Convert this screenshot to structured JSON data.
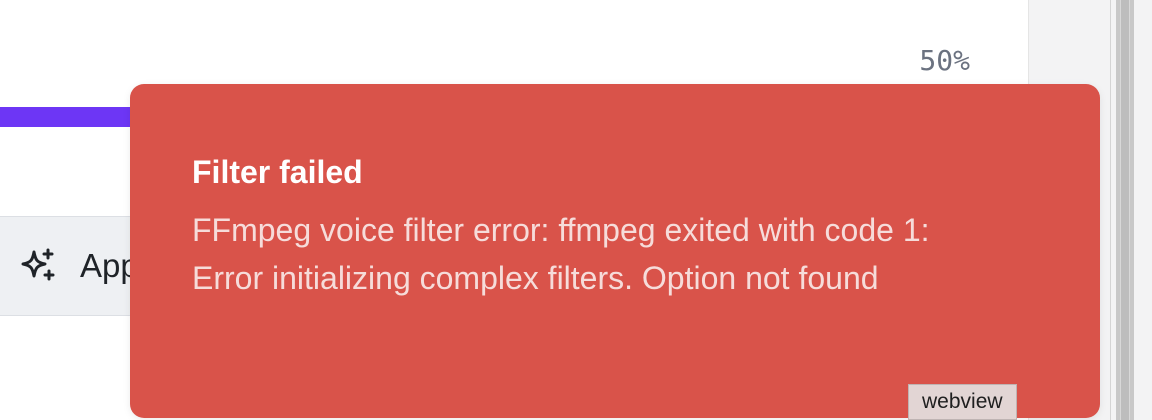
{
  "progress": {
    "percent_label": "50%",
    "value": 0.5,
    "fill_color": "#6d36f5"
  },
  "action": {
    "icon": "sparkles-icon",
    "label": "Apply"
  },
  "toast": {
    "title": "Filter failed",
    "message": "FFmpeg voice filter error: ffmpeg exited with code 1: Error initializing complex filters. Option not found",
    "background_color": "#d9534a"
  },
  "webview_label": "webview"
}
